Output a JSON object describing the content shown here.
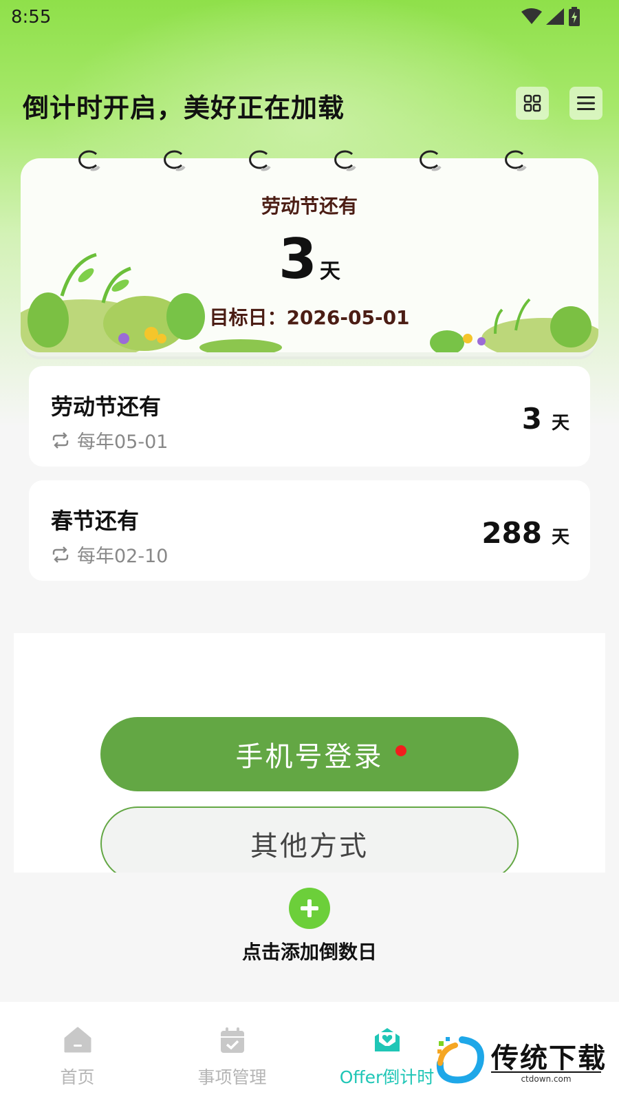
{
  "status_bar": {
    "time": "8:55"
  },
  "header": {
    "title": "倒计时开启，美好正在加载"
  },
  "calendar": {
    "event_title": "劳动节还有",
    "days": "3",
    "unit": "天",
    "target_label": "目标日：2026-05-01"
  },
  "items": [
    {
      "name": "劳动节还有",
      "repeat": "每年05-01",
      "days": "3",
      "unit": "天"
    },
    {
      "name": "春节还有",
      "repeat": "每年02-10",
      "days": "288",
      "unit": "天"
    }
  ],
  "login": {
    "phone_label": "手机号登录",
    "other_label": "其他方式"
  },
  "add": {
    "label": "点击添加倒数日"
  },
  "nav": {
    "items": [
      {
        "label": "首页"
      },
      {
        "label": "事项管理"
      },
      {
        "label": "Offer倒计时"
      }
    ]
  },
  "watermark": {
    "text": "传统下载",
    "sub": "ctdown.com"
  },
  "colors": {
    "accent_green": "#63a744",
    "nav_active": "#1fc6b6",
    "add_green": "#6ccf3a"
  }
}
